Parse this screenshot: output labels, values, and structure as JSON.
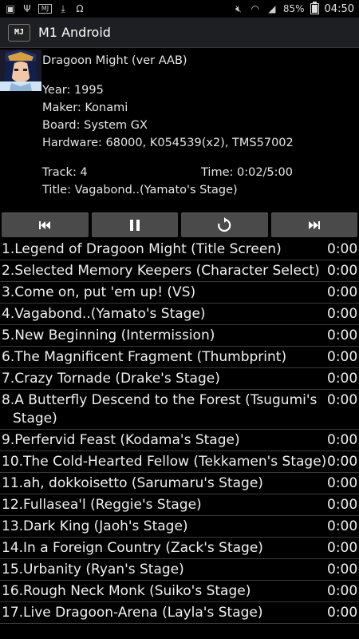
{
  "status": {
    "battery": "85%",
    "battery_level": 0.85,
    "time": "04:50"
  },
  "app": {
    "icon_text": "MJ",
    "title": "M1 Android"
  },
  "game": {
    "title": "Dragoon Might (ver AAB)",
    "year": "Year: 1995",
    "maker": "Maker: Konami",
    "board": "Board: System GX",
    "hardware": "Hardware: 68000, K054539(x2), TMS57002",
    "track": "Track: 4",
    "time": "Time: 0:02/5:00",
    "track_title": "Title: Vagabond..(Yamato's Stage)"
  },
  "controls": [
    "previous",
    "pause",
    "replay",
    "next"
  ],
  "tracks": [
    {
      "num": "1.",
      "name": "Legend of Dragoon Might (Title Screen)",
      "dur": "0:00"
    },
    {
      "num": "2.",
      "name": "Selected Memory Keepers (Character Select)",
      "dur": "0:00"
    },
    {
      "num": "3.",
      "name": "Come on, put 'em up! (VS)",
      "dur": "0:00"
    },
    {
      "num": "4.",
      "name": "Vagabond..(Yamato's Stage)",
      "dur": "0:00"
    },
    {
      "num": "5.",
      "name": "New Beginning (Intermission)",
      "dur": "0:00"
    },
    {
      "num": "6.",
      "name": "The Magnificent Fragment (Thumbprint)",
      "dur": "0:00"
    },
    {
      "num": "7.",
      "name": "Crazy Tornade (Drake's Stage)",
      "dur": "0:00"
    },
    {
      "num": "8.",
      "name": "A Butterfly Descend to the Forest (Tsugumi's Stage)",
      "dur": "0:00"
    },
    {
      "num": "9.",
      "name": "Perfervid Feast (Kodama's Stage)",
      "dur": "0:00"
    },
    {
      "num": "10.",
      "name": "The Cold-Hearted Fellow (Tekkamen's Stage)",
      "dur": "0:00"
    },
    {
      "num": "11.",
      "name": "ah, dokkoisetto (Sarumaru's Stage)",
      "dur": "0:00"
    },
    {
      "num": "12.",
      "name": "Fullasea'l (Reggie's Stage)",
      "dur": "0:00"
    },
    {
      "num": "13.",
      "name": "Dark King (Jaoh's Stage)",
      "dur": "0:00"
    },
    {
      "num": "14.",
      "name": "In a Foreign Country (Zack's Stage)",
      "dur": "0:00"
    },
    {
      "num": "15.",
      "name": "Urbanity (Ryan's Stage)",
      "dur": "0:00"
    },
    {
      "num": "16.",
      "name": "Rough Neck Monk (Suiko's Stage)",
      "dur": "0:00"
    },
    {
      "num": "17.",
      "name": "Live Dragoon-Arena (Layla's Stage)",
      "dur": "0:00"
    }
  ]
}
